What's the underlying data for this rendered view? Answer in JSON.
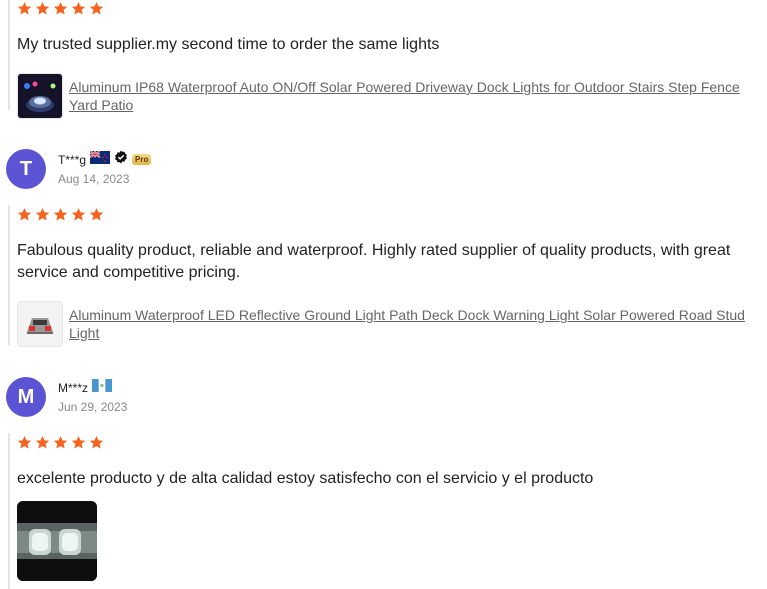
{
  "colors": {
    "star": "#f5631e",
    "avatar": "#5b55d6",
    "link": "#666666"
  },
  "reviews": [
    {
      "stars": 5,
      "text": "My trusted supplier.my second time to order the same lights",
      "product_title": "Aluminum IP68 Waterproof Auto ON/Off Solar Powered Driveway Dock Lights for Outdoor Stairs Step Fence Yard Patio",
      "product_thumb_icon": "solar-dock-light-image"
    },
    {
      "avatar_letter": "T",
      "user": "T***g",
      "flag_icon": "new-zealand-flag-icon",
      "verified_icon": "verified-check-icon",
      "badge": "Pro",
      "date": "Aug 14, 2023",
      "stars": 5,
      "text": "Fabulous quality product, reliable and waterproof. Highly rated supplier of quality products, with great service and competitive pricing.",
      "product_title": "Aluminum Waterproof LED Reflective Ground Light Path Deck Dock Warning Light Solar Powered Road Stud Light",
      "product_thumb_icon": "road-stud-light-image"
    },
    {
      "avatar_letter": "M",
      "user": "M***z",
      "flag_icon": "guatemala-flag-icon",
      "date": "Jun 29, 2023",
      "stars": 5,
      "text": "excelente producto y de alta calidad estoy satisfecho con el servicio y el producto",
      "photo_icon": "review-photo-lights"
    }
  ]
}
